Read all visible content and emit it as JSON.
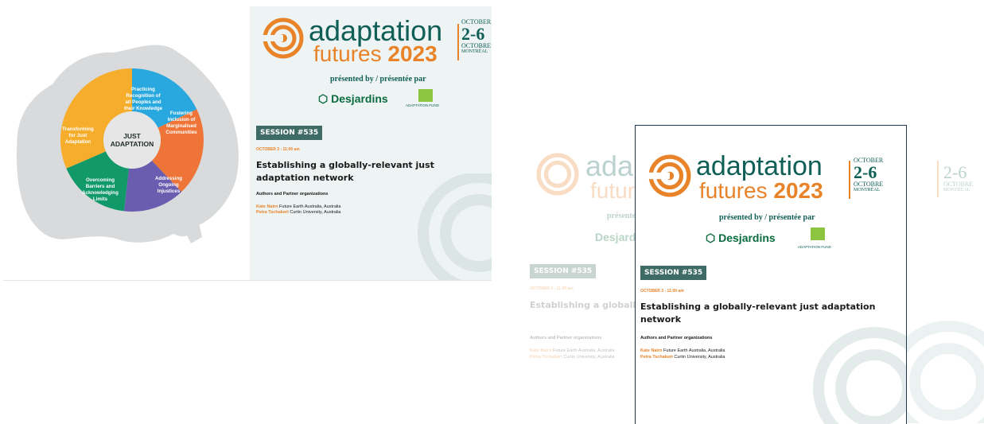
{
  "wheel": {
    "center": "JUST ADAPTATION",
    "segments": [
      {
        "label": "Practicing Recognition of all Peoples and their Knowledge",
        "color": "#29a8e0"
      },
      {
        "label": "Fostering Inclusion of Marginalised Communities",
        "color": "#ee7537"
      },
      {
        "label": "Addressing Ongoing Injustices",
        "color": "#6a5db0"
      },
      {
        "label": "Overcoming Barriers and Acknowledging Limits",
        "color": "#12996a"
      },
      {
        "label": "Transforming for Just Adaptation",
        "color": "#f7ad2c"
      }
    ]
  },
  "conference": {
    "word1": "adaptation",
    "word2": "futures",
    "year": "2023",
    "month_en": "OCTOBER",
    "days": "2-6",
    "month_fr": "OCTOBRE",
    "city": "MONTRÉAL",
    "presented_by": "présented by / présentée par",
    "sponsor1": "Desjardins",
    "sponsor2": "ADAPTATION FUND"
  },
  "session": {
    "badge": "SESSION #535",
    "datetime": "OCTOBER 3 - 11:00 am",
    "title": "Establishing a globally-relevant just adaptation network",
    "authors_heading": "Authors and Partner organizations",
    "authors": [
      {
        "name": "Kate Nairn",
        "affiliation": "Future Earth Australia, Australia"
      },
      {
        "name": "Petra Tschakert",
        "affiliation": "Curtin University, Australia"
      }
    ]
  },
  "colors": {
    "teal": "#0f5f57",
    "orange": "#e8832a",
    "badge": "#3f6b66"
  }
}
